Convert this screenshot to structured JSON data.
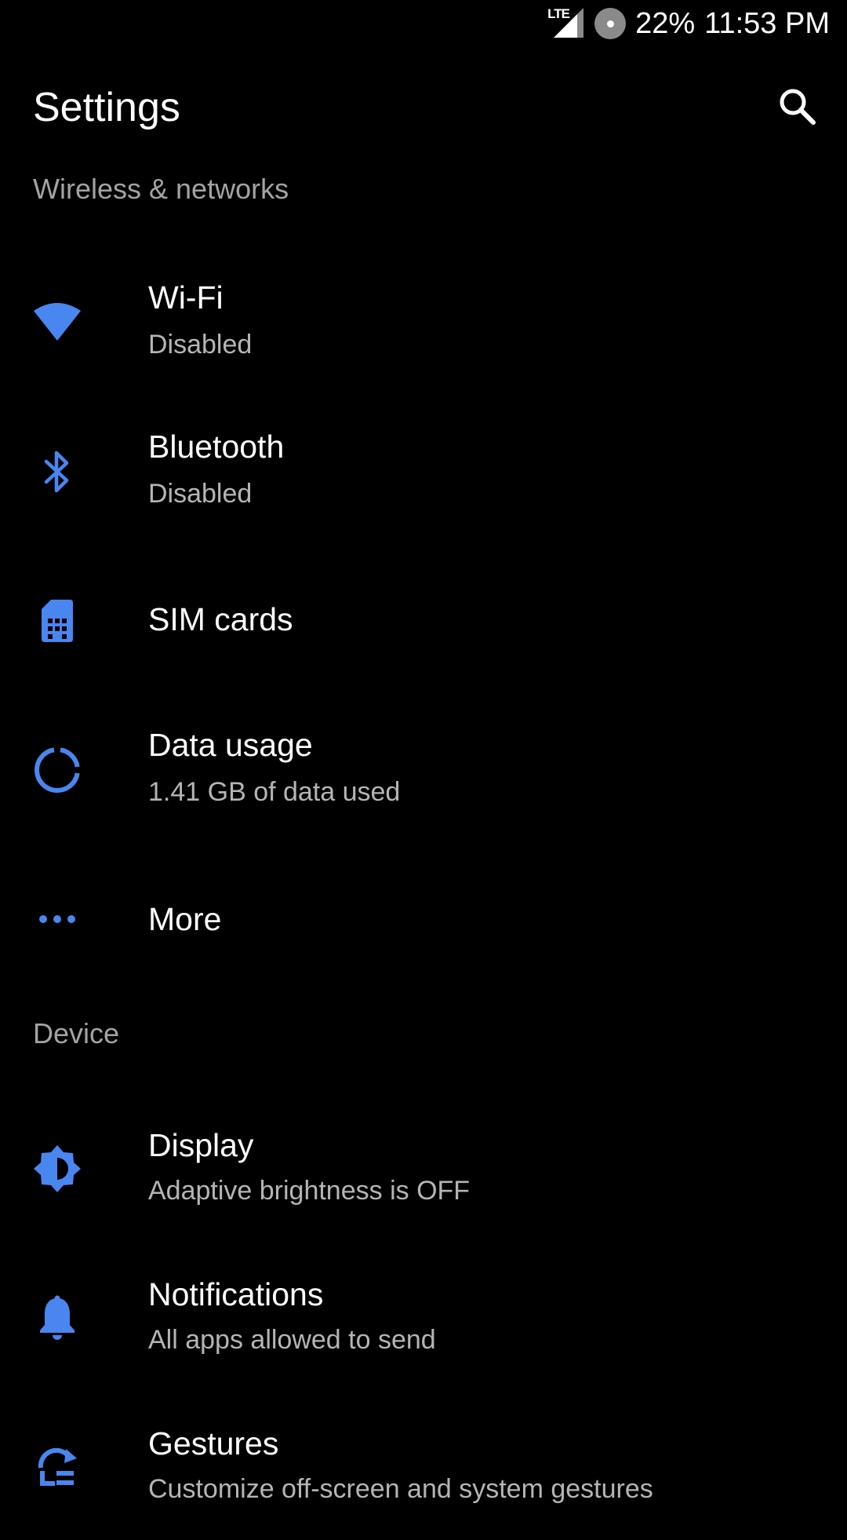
{
  "status_bar": {
    "network_label": "LTE",
    "battery": "22%",
    "time": "11:53 PM"
  },
  "header": {
    "title": "Settings",
    "search_icon": "search-icon"
  },
  "sections": {
    "wireless": {
      "header": "Wireless & networks",
      "items": [
        {
          "title": "Wi-Fi",
          "summary": "Disabled",
          "icon": "wifi-icon"
        },
        {
          "title": "Bluetooth",
          "summary": "Disabled",
          "icon": "bluetooth-icon"
        },
        {
          "title": "SIM cards",
          "icon": "sim-card-icon"
        },
        {
          "title": "Data usage",
          "summary": "1.41 GB of data used",
          "icon": "data-usage-icon"
        },
        {
          "title": "More",
          "icon": "more-dots-icon"
        }
      ]
    },
    "device": {
      "header": "Device",
      "items": [
        {
          "title": "Display",
          "summary": "Adaptive brightness is OFF",
          "icon": "brightness-icon"
        },
        {
          "title": "Notifications",
          "summary": "All apps allowed to send",
          "icon": "bell-icon"
        },
        {
          "title": "Gestures",
          "summary": "Customize off-screen and system gestures",
          "icon": "gestures-icon"
        }
      ]
    }
  },
  "colors": {
    "background": "#000000",
    "accent": "#4a86f0",
    "primary_text": "#ffffff",
    "secondary_text": "#b5b5b5",
    "section_header": "#a3a3a3"
  }
}
